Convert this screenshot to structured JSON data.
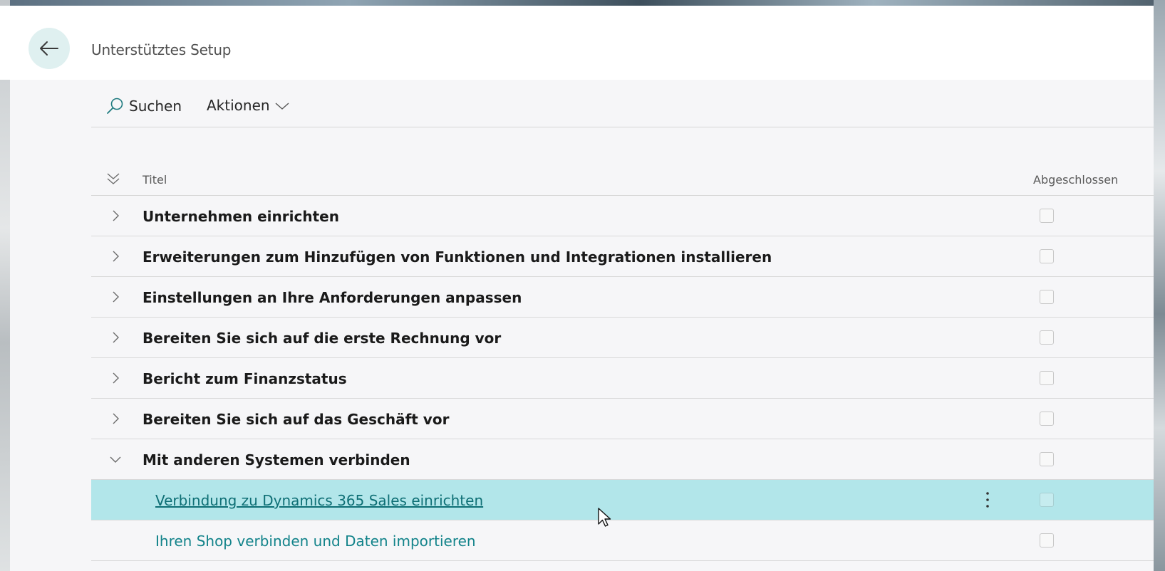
{
  "header": {
    "title": "Unterstütztes Setup"
  },
  "toolbar": {
    "search_label": "Suchen",
    "actions_label": "Aktionen"
  },
  "table": {
    "col_title": "Titel",
    "col_done": "Abgeschlossen",
    "rows": [
      {
        "label": "Unternehmen einrichten",
        "expanded": false,
        "completed": false
      },
      {
        "label": "Erweiterungen zum Hinzufügen von Funktionen und Integrationen installieren",
        "expanded": false,
        "completed": false
      },
      {
        "label": "Einstellungen an Ihre Anforderungen anpassen",
        "expanded": false,
        "completed": false
      },
      {
        "label": "Bereiten Sie sich auf die erste Rechnung vor",
        "expanded": false,
        "completed": false
      },
      {
        "label": "Bericht zum Finanzstatus",
        "expanded": false,
        "completed": false
      },
      {
        "label": "Bereiten Sie sich auf das Geschäft vor",
        "expanded": false,
        "completed": false
      },
      {
        "label": "Mit anderen Systemen verbinden",
        "expanded": true,
        "completed": false
      },
      {
        "label": "Verbindung zu Dynamics 365 Sales einrichten",
        "child": true,
        "selected": true,
        "completed": false
      },
      {
        "label": "Ihren Shop verbinden und Daten importieren",
        "child": true,
        "selected": false,
        "completed": false
      }
    ]
  },
  "colors": {
    "selected_row": "#b2e6ea",
    "link": "#12838a",
    "back_button_bg": "#dff0f0"
  }
}
